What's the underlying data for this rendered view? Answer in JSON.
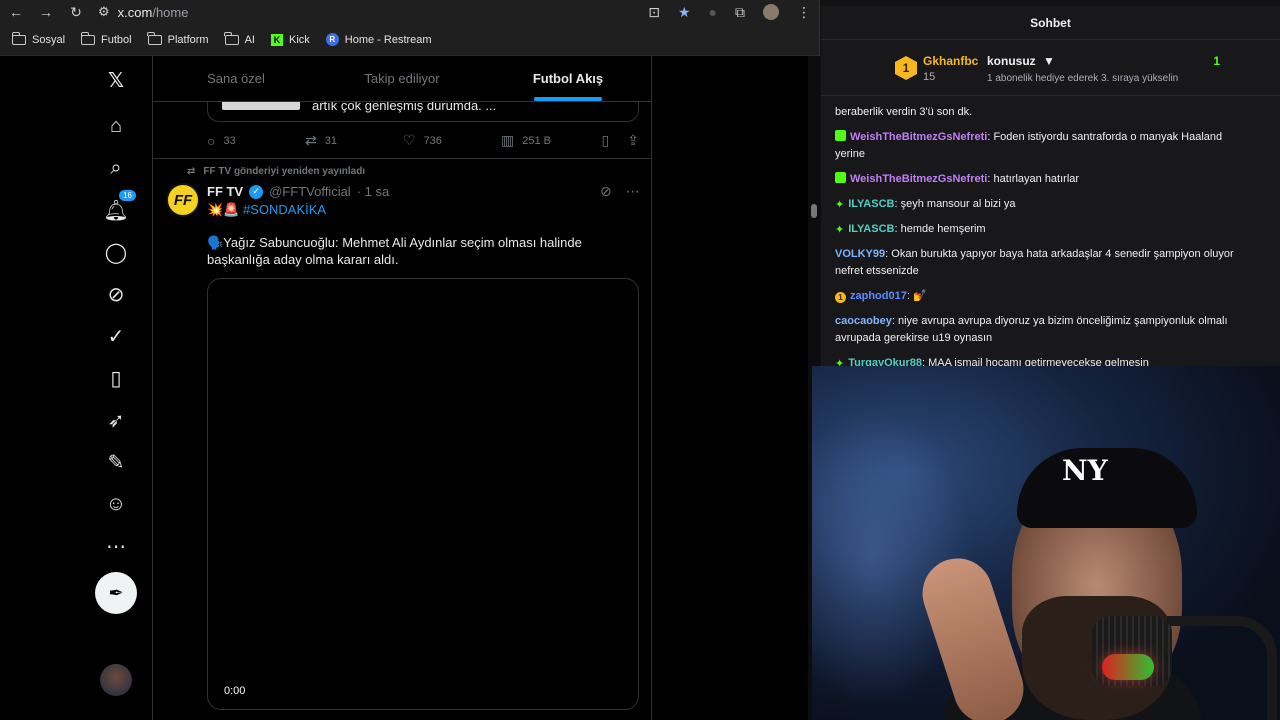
{
  "browser": {
    "url_host": "x.com",
    "url_path": "/home",
    "bookmarks": [
      {
        "label": "Sosyal"
      },
      {
        "label": "Futbol"
      },
      {
        "label": "Platform"
      },
      {
        "label": "AI"
      },
      {
        "label": "Kick"
      },
      {
        "label": "Home - Restream"
      }
    ]
  },
  "x": {
    "notifications_count": "16",
    "tabs": [
      "Sana özel",
      "Takip ediliyor",
      "Futbol Akış"
    ],
    "prev_post": {
      "text": "artık çok genleşmiş durumda. ...",
      "replies": "33",
      "reposts": "31",
      "likes": "736",
      "views": "251 B"
    },
    "tweet": {
      "repost_note": "FF TV gönderiyi yeniden yayınladı",
      "avatar_text": "FF",
      "name": "FF TV",
      "handle": "@FFTVofficial",
      "time": "· 1 sa",
      "emoji": "💥🚨",
      "hashtag": "#SONDAKİKA",
      "text": "🗣️Yağız Sabuncuoğlu: Mehmet Ali Aydınlar seçim olması halinde başkanlığa aday olma kararı aldı.",
      "video_time": "0:00"
    }
  },
  "chat": {
    "title": "Sohbet",
    "gift": {
      "rank": "1",
      "user": "Gkhanfbc",
      "count_left": "15",
      "topic": "konusuz",
      "count_right": "1",
      "message": "1 abonelik hediye ederek 3. sıraya yükselin"
    },
    "messages": [
      {
        "badge": "",
        "user": "",
        "color": "#efeff1",
        "text": "beraberlik verdin 3'ü son dk."
      },
      {
        "badge": "sub",
        "user": "WeishTheBitmezGsNefreti",
        "color": "#c27ef5",
        "text": "Foden istiyordu santraforda o manyak Haaland yerine"
      },
      {
        "badge": "sub",
        "user": "WeishTheBitmezGsNefreti",
        "color": "#c27ef5",
        "text": "hatırlayan hatırlar"
      },
      {
        "badge": "spark",
        "user": "ILYASCB",
        "color": "#4fd1c5",
        "text": "şeyh mansour al bizi ya"
      },
      {
        "badge": "spark",
        "user": "ILYASCB",
        "color": "#4fd1c5",
        "text": "hemde hemşerim"
      },
      {
        "badge": "",
        "user": "VOLKY99",
        "color": "#7db5ff",
        "text": "Okan burukta yapıyor baya hata arkadaşlar 4 senedir şampiyon oluyor nefret etssenizde"
      },
      {
        "badge": "coin",
        "user": "zaphod017",
        "color": "#5b8cff",
        "text": "💅"
      },
      {
        "badge": "",
        "user": "caocaobey",
        "color": "#7db5ff",
        "text": "niye avrupa avrupa diyoruz ya bizim önceliğimiz şampiyonluk olmalı avrupada gerekirse u19 oynasın"
      },
      {
        "badge": "spark",
        "user": "TurgayOkur88",
        "color": "#4fd1c5",
        "text": "MAA ismail hocamı getirmeyecekse gelmesin"
      }
    ]
  },
  "webcam": {
    "cap_logo": "NY"
  }
}
